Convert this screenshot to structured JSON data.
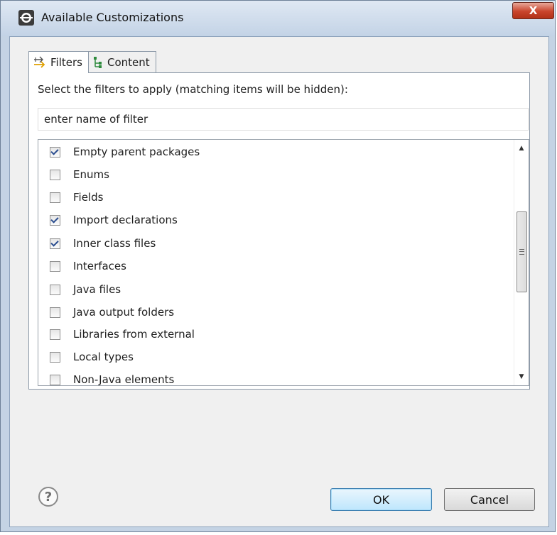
{
  "window": {
    "title": "Available Customizations",
    "close_label": "X"
  },
  "tabs": [
    {
      "label": "Filters",
      "icon": "filter-arrows-icon",
      "active": true
    },
    {
      "label": "Content",
      "icon": "tree-content-icon",
      "active": false
    }
  ],
  "filters": {
    "instruction": "Select the filters to apply (matching items will be hidden):",
    "search_placeholder": "enter name of filter",
    "items": [
      {
        "label": "Empty parent packages",
        "checked": true
      },
      {
        "label": "Enums",
        "checked": false
      },
      {
        "label": "Fields",
        "checked": false
      },
      {
        "label": "Import declarations",
        "checked": true
      },
      {
        "label": "Inner class files",
        "checked": true
      },
      {
        "label": "Interfaces",
        "checked": false
      },
      {
        "label": "Java files",
        "checked": false
      },
      {
        "label": "Java output folders",
        "checked": false
      },
      {
        "label": "Libraries from external",
        "checked": false
      },
      {
        "label": "Local types",
        "checked": false
      },
      {
        "label": "Non-Java elements",
        "checked": false
      }
    ]
  },
  "footer": {
    "help_symbol": "?",
    "ok_label": "OK",
    "cancel_label": "Cancel"
  }
}
